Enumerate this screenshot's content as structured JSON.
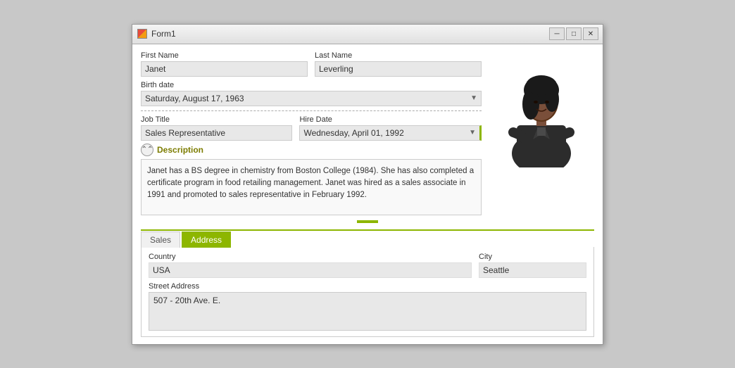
{
  "window": {
    "title": "Form1",
    "minimize_label": "─",
    "maximize_label": "□",
    "close_label": "✕"
  },
  "form": {
    "first_name_label": "First Name",
    "first_name_value": "Janet",
    "last_name_label": "Last Name",
    "last_name_value": "Leverling",
    "birth_date_label": "Birth date",
    "birth_date_value": "Saturday, August 17, 1963",
    "job_title_label": "Job Title",
    "job_title_value": "Sales Representative",
    "hire_date_label": "Hire Date",
    "hire_date_value": "Wednesday, April 01, 1992",
    "description_label": "Description",
    "description_text": "Janet has a BS degree in chemistry from Boston College (1984).  She has also completed a certificate program in food retailing management.  Janet was hired as a sales associate in 1991 and promoted to sales representative in February 1992.",
    "tabs": [
      {
        "label": "Sales",
        "active": false
      },
      {
        "label": "Address",
        "active": true
      }
    ],
    "address": {
      "country_label": "Country",
      "country_value": "USA",
      "city_label": "City",
      "city_value": "Seattle",
      "street_address_label": "Street Address",
      "street_address_value": "507 - 20th Ave. E."
    }
  }
}
